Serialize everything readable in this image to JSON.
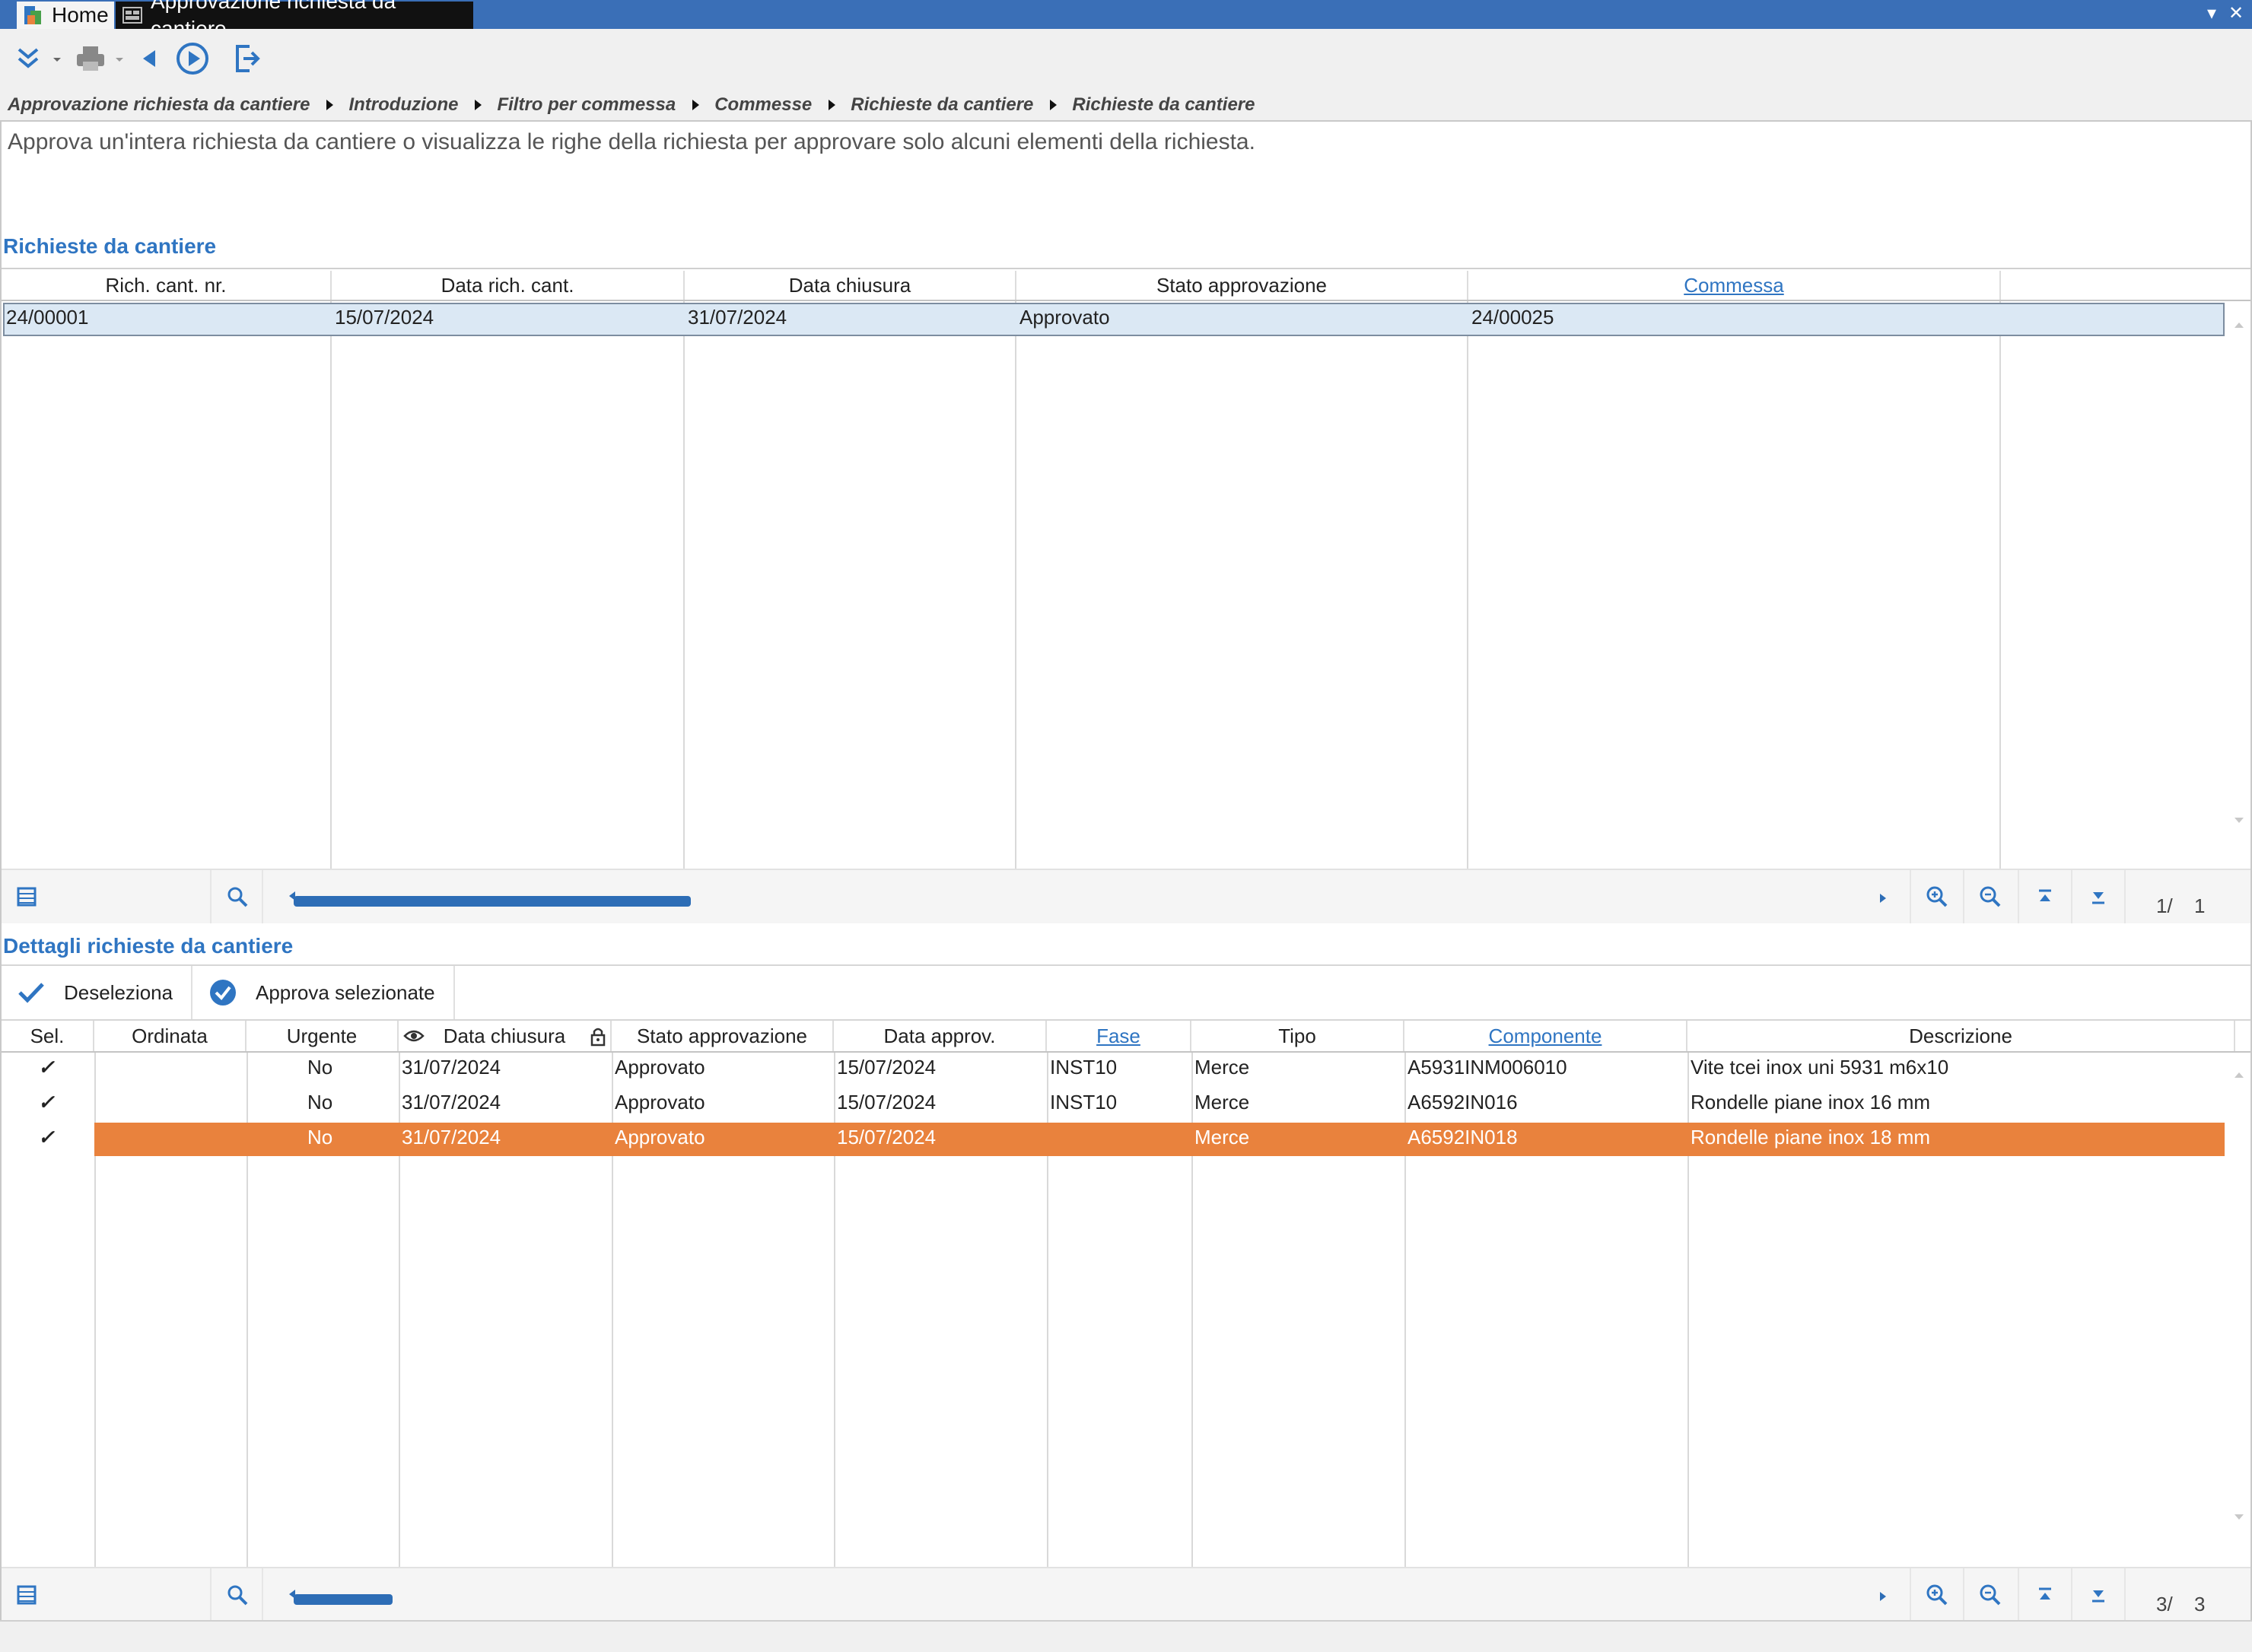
{
  "window": {
    "tabs": [
      {
        "label": "Home",
        "icon": "app-icon"
      },
      {
        "label": "Approvazione richiesta da cantiere",
        "icon": "form-icon"
      }
    ],
    "controls": {
      "dropdown": "▾",
      "close": "✕"
    },
    "accent_color": "#3a6fb7"
  },
  "toolbar": {
    "buttons": [
      "collapse-icon",
      "print-icon",
      "back-icon",
      "play-icon",
      "exit-icon"
    ]
  },
  "breadcrumb": [
    "Approvazione richiesta da cantiere",
    "Introduzione",
    "Filtro per commessa",
    "Commesse",
    "Richieste da cantiere",
    "Richieste da cantiere"
  ],
  "intro_text": "Approva un'intera richiesta da cantiere o visualizza le righe della richiesta per approvare solo alcuni elementi della richiesta.",
  "requests": {
    "title": "Richieste da cantiere",
    "columns": [
      "Rich. cant. nr.",
      "Data rich. cant.",
      "Data chiusura",
      "Stato approvazione",
      "Commessa"
    ],
    "rows": [
      [
        "24/00001",
        "15/07/2024",
        "31/07/2024",
        "Approvato",
        "24/00025"
      ]
    ],
    "selected_row_color": "#dbe8f4",
    "pager": {
      "current": "1/",
      "total": "1"
    }
  },
  "details": {
    "title": "Dettagli richieste da cantiere",
    "actions": {
      "deselect": "Deseleziona",
      "approve": "Approva selezionate"
    },
    "columns": [
      "Sel.",
      "Ordinata",
      "Urgente",
      "Data chiusura",
      "Stato approvazione",
      "Data approv.",
      "Fase",
      "Tipo",
      "Componente",
      "Descrizione"
    ],
    "rows": [
      [
        "✓",
        "",
        "No",
        "31/07/2024",
        "Approvato",
        "15/07/2024",
        "INST10",
        "Merce",
        "A5931INM006010",
        "Vite tcei inox uni 5931 m6x10"
      ],
      [
        "✓",
        "",
        "No",
        "31/07/2024",
        "Approvato",
        "15/07/2024",
        "INST10",
        "Merce",
        "A6592IN016",
        "Rondelle piane inox 16 mm"
      ],
      [
        "✓",
        "",
        "No",
        "31/07/2024",
        "Approvato",
        "15/07/2024",
        "",
        "Merce",
        "A6592IN018",
        "Rondelle piane inox 18 mm"
      ]
    ],
    "highlight_row_color": "#e9823d",
    "pager": {
      "current": "3/",
      "total": "3"
    }
  }
}
